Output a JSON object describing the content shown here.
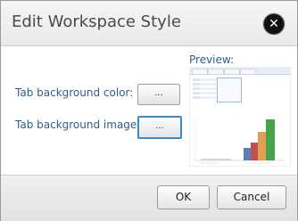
{
  "dialog": {
    "title": "Edit Workspace Style",
    "close_icon": "close-icon"
  },
  "fields": {
    "tab_background_color_label": "Tab background color:",
    "tab_background_color_button": "...",
    "tab_background_image_label": "Tab background image:",
    "tab_background_image_button": "..."
  },
  "preview": {
    "label": "Preview:",
    "chart_colors": [
      "#5b7fb5",
      "#c0504d",
      "#e0a050",
      "#4aa34a"
    ]
  },
  "footer": {
    "ok_label": "OK",
    "cancel_label": "Cancel"
  }
}
